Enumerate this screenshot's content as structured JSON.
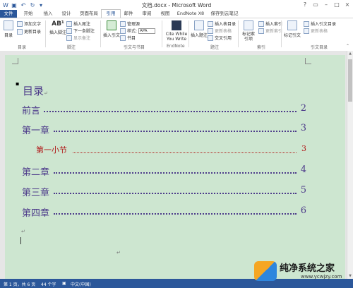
{
  "window": {
    "title": "文档.docx - Microsoft Word"
  },
  "tabs": [
    {
      "label": "文件"
    },
    {
      "label": "开始"
    },
    {
      "label": "插入"
    },
    {
      "label": "设计"
    },
    {
      "label": "页面布局"
    },
    {
      "label": "引用"
    },
    {
      "label": "邮件"
    },
    {
      "label": "审阅"
    },
    {
      "label": "视图"
    },
    {
      "label": "EndNote X8"
    },
    {
      "label": "保存到云笔记"
    }
  ],
  "ribbon": {
    "toc": {
      "big": "目录",
      "add_text": "添加文字",
      "update": "更新目录",
      "group": "目录"
    },
    "footnote": {
      "insert": "插入脚注",
      "insert_endnote": "插入尾注",
      "next": "下一条脚注",
      "show": "显示备注",
      "group": "脚注"
    },
    "citation": {
      "insert": "插入引文",
      "manage": "管理源",
      "style_label": "样式:",
      "style_value": "APA",
      "bib": "书目",
      "group": "引文与书目"
    },
    "endnote": {
      "cite": "Cite While You Write",
      "group": "EndNote"
    },
    "captions": {
      "insert": "插入题注",
      "table": "插入表目录",
      "update": "更新表格",
      "cross": "交叉引用",
      "group": "题注"
    },
    "index": {
      "mark": "标记索引项",
      "insert": "插入索引",
      "update": "更新索引",
      "group": "索引"
    },
    "authorities": {
      "mark": "标记引文",
      "insert": "插入引文目录",
      "update": "更新表格",
      "group": "引文目录"
    }
  },
  "document": {
    "toc_title": "目录",
    "entries": [
      {
        "text": "前言",
        "page": "2",
        "level": 1
      },
      {
        "text": "第一章",
        "page": "3",
        "level": 1
      },
      {
        "text": "第一小节",
        "page": "3",
        "level": 2
      },
      {
        "text": "第二章",
        "page": "4",
        "level": 1
      },
      {
        "text": "第三章",
        "page": "5",
        "level": 1
      },
      {
        "text": "第四章",
        "page": "6",
        "level": 1
      }
    ],
    "para_mark": "↵"
  },
  "status": {
    "page": "第 1 页，共 6 页",
    "words": "44 个字",
    "language": "中文(中国)"
  },
  "watermark": {
    "name": "纯净系统之家",
    "url": "www.ycwjzy.com"
  },
  "colors": {
    "file_tab": "#2b579a",
    "toc_text": "#4d3b8a",
    "subsection": "#b11a1a",
    "page_bg": "#cde6d0"
  }
}
